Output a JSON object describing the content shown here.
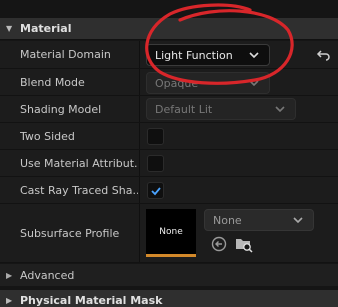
{
  "section": {
    "title": "Material"
  },
  "rows": {
    "material_domain": {
      "label": "Material Domain",
      "value": "Light Function"
    },
    "blend_mode": {
      "label": "Blend Mode",
      "value": "Opaque"
    },
    "shading_model": {
      "label": "Shading Model",
      "value": "Default Lit"
    },
    "two_sided": {
      "label": "Two Sided",
      "checked": false
    },
    "use_material_attributes": {
      "label": "Use Material Attribut...",
      "checked": false
    },
    "cast_ray_traced_shadows": {
      "label": "Cast Ray Traced Sha...",
      "checked": true
    },
    "subsurface_profile": {
      "label": "Subsurface Profile",
      "thumbnail": "None",
      "value": "None"
    }
  },
  "collapsed": {
    "advanced": "Advanced",
    "physical_material_mask": "Physical Material Mask"
  },
  "colors": {
    "accent_check": "#4aa3ff",
    "thumb_border": "#d3892a",
    "annotation": "#d8262a"
  },
  "icons": {
    "reset": "reset-arrow-icon",
    "use_selected": "use-selected-arrow-icon",
    "browse": "browse-folder-icon"
  }
}
